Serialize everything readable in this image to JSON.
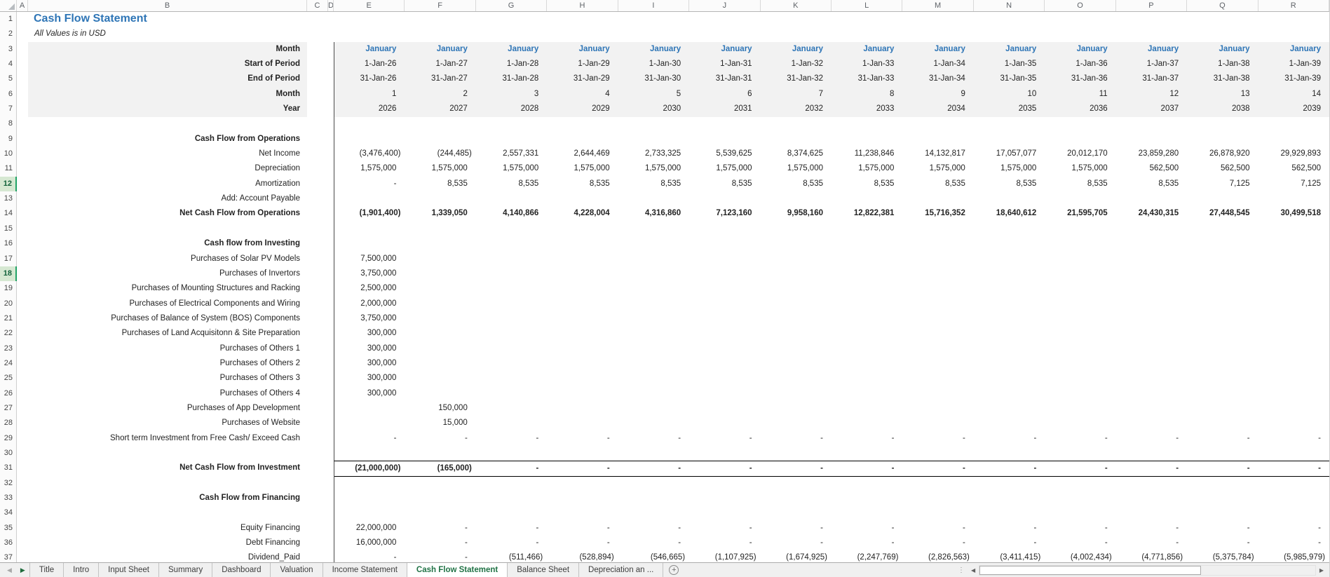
{
  "colors": {
    "title_blue": "#2E75B6",
    "month_blue": "#2E75B6",
    "active_tab_green": "#217346",
    "selected_row_bg": "#D6E8D2",
    "header_shade": "#F2F2F2"
  },
  "column_letters": [
    "A",
    "B",
    "C",
    "D",
    "E",
    "F",
    "G",
    "H",
    "I",
    "J",
    "K",
    "L",
    "M",
    "N",
    "O",
    "P",
    "Q",
    "R"
  ],
  "sheet": {
    "title": "Cash Flow Statement",
    "subtitle": "All Values is in USD"
  },
  "rows": [
    {
      "num": 1,
      "label": "Cash Flow Statement",
      "lstyle": "title",
      "values": []
    },
    {
      "num": 2,
      "label": "All Values is in USD",
      "lstyle": "subtitle",
      "values": []
    },
    {
      "num": 3,
      "label": "Month",
      "lstyle": "hdr",
      "shaded": true,
      "vstyle": "month",
      "values": [
        "January",
        "January",
        "January",
        "January",
        "January",
        "January",
        "January",
        "January",
        "January",
        "January",
        "January",
        "January",
        "January",
        "January"
      ]
    },
    {
      "num": 4,
      "label": "Start of Period",
      "lstyle": "hdr",
      "shaded": true,
      "values": [
        "1-Jan-26",
        "1-Jan-27",
        "1-Jan-28",
        "1-Jan-29",
        "1-Jan-30",
        "1-Jan-31",
        "1-Jan-32",
        "1-Jan-33",
        "1-Jan-34",
        "1-Jan-35",
        "1-Jan-36",
        "1-Jan-37",
        "1-Jan-38",
        "1-Jan-39"
      ]
    },
    {
      "num": 5,
      "label": "End of Period",
      "lstyle": "hdr",
      "shaded": true,
      "values": [
        "31-Jan-26",
        "31-Jan-27",
        "31-Jan-28",
        "31-Jan-29",
        "31-Jan-30",
        "31-Jan-31",
        "31-Jan-32",
        "31-Jan-33",
        "31-Jan-34",
        "31-Jan-35",
        "31-Jan-36",
        "31-Jan-37",
        "31-Jan-38",
        "31-Jan-39"
      ]
    },
    {
      "num": 6,
      "label": "Month",
      "lstyle": "hdr",
      "shaded": true,
      "values": [
        "1",
        "2",
        "3",
        "4",
        "5",
        "6",
        "7",
        "8",
        "9",
        "10",
        "11",
        "12",
        "13",
        "14"
      ]
    },
    {
      "num": 7,
      "label": "Year",
      "lstyle": "hdr",
      "shaded": true,
      "values": [
        "2026",
        "2027",
        "2028",
        "2029",
        "2030",
        "2031",
        "2032",
        "2033",
        "2034",
        "2035",
        "2036",
        "2037",
        "2038",
        "2039"
      ]
    },
    {
      "num": 8,
      "label": "",
      "values": []
    },
    {
      "num": 9,
      "label": "Cash Flow from Operations",
      "lstyle": "hdr",
      "values": []
    },
    {
      "num": 10,
      "label": "Net Income",
      "values": [
        "(3,476,400)",
        "(244,485)",
        "2,557,331",
        "2,644,469",
        "2,733,325",
        "5,539,625",
        "8,374,625",
        "11,238,846",
        "14,132,817",
        "17,057,077",
        "20,012,170",
        "23,859,280",
        "26,878,920",
        "29,929,893"
      ]
    },
    {
      "num": 11,
      "label": "Depreciation",
      "values": [
        "1,575,000",
        "1,575,000",
        "1,575,000",
        "1,575,000",
        "1,575,000",
        "1,575,000",
        "1,575,000",
        "1,575,000",
        "1,575,000",
        "1,575,000",
        "1,575,000",
        "562,500",
        "562,500",
        "562,500"
      ]
    },
    {
      "num": 12,
      "label": "Amortization",
      "selected": true,
      "values": [
        "-",
        "8,535",
        "8,535",
        "8,535",
        "8,535",
        "8,535",
        "8,535",
        "8,535",
        "8,535",
        "8,535",
        "8,535",
        "8,535",
        "7,125",
        "7,125"
      ]
    },
    {
      "num": 13,
      "label": "Add: Account Payable",
      "values": []
    },
    {
      "num": 14,
      "label": "Net Cash Flow from Operations",
      "lstyle": "hdr",
      "vstyle": "bold",
      "values": [
        "(1,901,400)",
        "1,339,050",
        "4,140,866",
        "4,228,004",
        "4,316,860",
        "7,123,160",
        "9,958,160",
        "12,822,381",
        "15,716,352",
        "18,640,612",
        "21,595,705",
        "24,430,315",
        "27,448,545",
        "30,499,518"
      ]
    },
    {
      "num": 15,
      "label": "",
      "values": []
    },
    {
      "num": 16,
      "label": "Cash flow from Investing",
      "lstyle": "hdr",
      "values": []
    },
    {
      "num": 17,
      "label": "Purchases of Solar PV Models",
      "values": [
        "7,500,000",
        "",
        "",
        "",
        "",
        "",
        "",
        "",
        "",
        "",
        "",
        "",
        "",
        ""
      ]
    },
    {
      "num": 18,
      "label": "Purchases of Invertors",
      "selected": true,
      "values": [
        "3,750,000",
        "",
        "",
        "",
        "",
        "",
        "",
        "",
        "",
        "",
        "",
        "",
        "",
        ""
      ]
    },
    {
      "num": 19,
      "label": "Purchases of Mounting Structures and Racking",
      "values": [
        "2,500,000",
        "",
        "",
        "",
        "",
        "",
        "",
        "",
        "",
        "",
        "",
        "",
        "",
        ""
      ]
    },
    {
      "num": 20,
      "label": "Purchases of Electrical Components and Wiring",
      "values": [
        "2,000,000",
        "",
        "",
        "",
        "",
        "",
        "",
        "",
        "",
        "",
        "",
        "",
        "",
        ""
      ]
    },
    {
      "num": 21,
      "label": "Purchases of Balance of System (BOS) Components",
      "values": [
        "3,750,000",
        "",
        "",
        "",
        "",
        "",
        "",
        "",
        "",
        "",
        "",
        "",
        "",
        ""
      ]
    },
    {
      "num": 22,
      "label": "Purchases of Land Acquisitonn & Site Preparation",
      "values": [
        "300,000",
        "",
        "",
        "",
        "",
        "",
        "",
        "",
        "",
        "",
        "",
        "",
        "",
        ""
      ]
    },
    {
      "num": 23,
      "label": "Purchases of Others 1",
      "values": [
        "300,000",
        "",
        "",
        "",
        "",
        "",
        "",
        "",
        "",
        "",
        "",
        "",
        "",
        ""
      ]
    },
    {
      "num": 24,
      "label": "Purchases of Others 2",
      "values": [
        "300,000",
        "",
        "",
        "",
        "",
        "",
        "",
        "",
        "",
        "",
        "",
        "",
        "",
        ""
      ]
    },
    {
      "num": 25,
      "label": "Purchases of Others 3",
      "values": [
        "300,000",
        "",
        "",
        "",
        "",
        "",
        "",
        "",
        "",
        "",
        "",
        "",
        "",
        ""
      ]
    },
    {
      "num": 26,
      "label": "Purchases of Others 4",
      "values": [
        "300,000",
        "",
        "",
        "",
        "",
        "",
        "",
        "",
        "",
        "",
        "",
        "",
        "",
        ""
      ]
    },
    {
      "num": 27,
      "label": "Purchases of App Development",
      "values": [
        "",
        "150,000",
        "",
        "",
        "",
        "",
        "",
        "",
        "",
        "",
        "",
        "",
        "",
        ""
      ]
    },
    {
      "num": 28,
      "label": "Purchases of Website",
      "values": [
        "",
        "15,000",
        "",
        "",
        "",
        "",
        "",
        "",
        "",
        "",
        "",
        "",
        "",
        ""
      ]
    },
    {
      "num": 29,
      "label": "Short term Investment from Free Cash/ Exceed Cash",
      "values": [
        "-",
        "-",
        "-",
        "-",
        "-",
        "-",
        "-",
        "-",
        "-",
        "-",
        "-",
        "-",
        "-",
        "-"
      ]
    },
    {
      "num": 30,
      "label": "",
      "values": []
    },
    {
      "num": 31,
      "label": "Net Cash Flow from Investment",
      "lstyle": "hdr",
      "vstyle": "bold",
      "total": true,
      "values": [
        "(21,000,000)",
        "(165,000)",
        "-",
        "-",
        "-",
        "-",
        "-",
        "-",
        "-",
        "-",
        "-",
        "-",
        "-",
        "-"
      ]
    },
    {
      "num": 32,
      "label": "",
      "values": []
    },
    {
      "num": 33,
      "label": "Cash Flow from Financing",
      "lstyle": "hdr",
      "values": []
    },
    {
      "num": 34,
      "label": "",
      "values": []
    },
    {
      "num": 35,
      "label": "Equity Financing",
      "values": [
        "22,000,000",
        "-",
        "-",
        "-",
        "-",
        "-",
        "-",
        "-",
        "-",
        "-",
        "-",
        "-",
        "-",
        "-"
      ]
    },
    {
      "num": 36,
      "label": "Debt Financing",
      "values": [
        "16,000,000",
        "-",
        "-",
        "-",
        "-",
        "-",
        "-",
        "-",
        "-",
        "-",
        "-",
        "-",
        "-",
        "-"
      ]
    },
    {
      "num": 37,
      "label": "Dividend_Paid",
      "values": [
        "-",
        "-",
        "(511,466)",
        "(528,894)",
        "(546,665)",
        "(1,107,925)",
        "(1,674,925)",
        "(2,247,769)",
        "(2,826,563)",
        "(3,411,415)",
        "(4,002,434)",
        "(4,771,856)",
        "(5,375,784)",
        "(5,985,979)"
      ]
    }
  ],
  "tab_bar": {
    "nav_prev": "◀",
    "nav_next": "▶",
    "tabs": [
      {
        "label": "Title",
        "active": false
      },
      {
        "label": "Intro",
        "active": false
      },
      {
        "label": "Input Sheet",
        "active": false
      },
      {
        "label": "Summary",
        "active": false
      },
      {
        "label": "Dashboard",
        "active": false
      },
      {
        "label": "Valuation",
        "active": false
      },
      {
        "label": "Income Statement",
        "active": false
      },
      {
        "label": "Cash Flow Statement",
        "active": true
      },
      {
        "label": "Balance Sheet",
        "active": false
      },
      {
        "label": "Depreciation an ...",
        "active": false
      }
    ],
    "add_label": "+",
    "splitter_icon": "⋮",
    "scroll_left": "◀",
    "scroll_right": "▶"
  }
}
